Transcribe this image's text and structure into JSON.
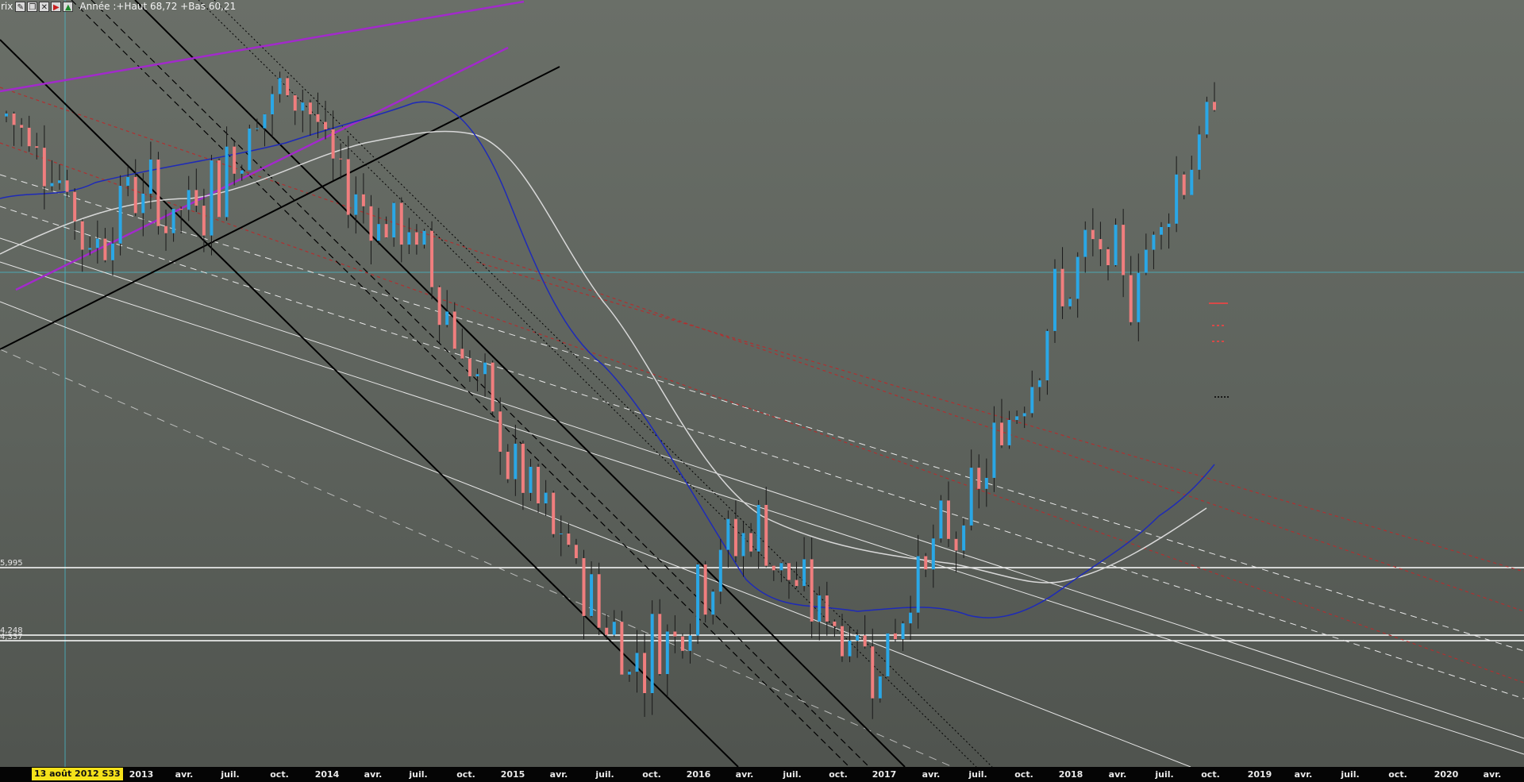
{
  "toolbar": {
    "left_label": "rix",
    "icons": [
      "pencil-icon",
      "window-icon",
      "close-icon",
      "flag-icon",
      "up-arrow-icon"
    ],
    "title": "Année :+Haut 68,72 +Bas 60,21"
  },
  "levels": [
    "5,995",
    "4,248",
    "4,337"
  ],
  "xaxis": {
    "date_badge": "13 août 2012 S33",
    "ticks": [
      "2013",
      "avr.",
      "juil.",
      "oct.",
      "2014",
      "avr.",
      "juil.",
      "oct.",
      "2015",
      "avr.",
      "juil.",
      "oct.",
      "2016",
      "avr.",
      "juil.",
      "oct.",
      "2017",
      "avr.",
      "juil.",
      "oct.",
      "2018",
      "avr.",
      "juil.",
      "oct.",
      "2019",
      "avr.",
      "juil.",
      "oct.",
      "2020",
      "avr."
    ]
  },
  "colors": {
    "bull": "#2aa7e6",
    "bear": "#f07e7e",
    "ma_short": "#1e2ab8",
    "ma_long": "#d8d8d8",
    "channel": "#a22acb",
    "trend_black": "#000000",
    "trend_red": "#b03030"
  },
  "chart_data": {
    "type": "candlestick",
    "title": "Année :+Haut 68,72 +Bas 60,21",
    "x_start": "2012-08-13",
    "x_end": "2020-04",
    "price_levels": [
      "5,995",
      "4,248",
      "4,337"
    ],
    "series": [
      {
        "name": "",
        "values": [
          62,
          61,
          58,
          60,
          59,
          60,
          62,
          63,
          60,
          59,
          58,
          55,
          52,
          50,
          48,
          46,
          47,
          49,
          50,
          48,
          47,
          46,
          49,
          50,
          53,
          56,
          58,
          57,
          60,
          62
        ]
      }
    ]
  }
}
